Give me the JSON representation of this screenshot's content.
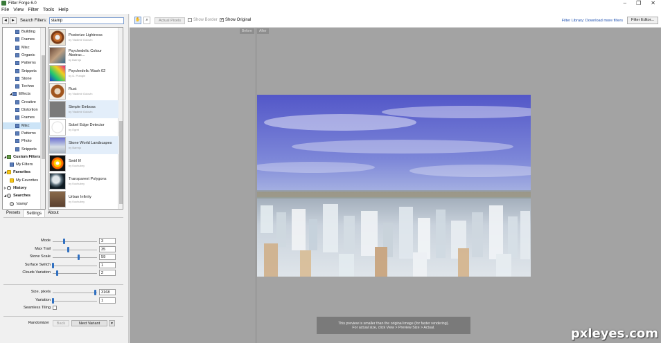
{
  "window": {
    "title": "Filter Forge 6.0",
    "controls": [
      "–",
      "❐",
      "✕"
    ]
  },
  "menu": [
    "File",
    "View",
    "Filter",
    "Tools",
    "Help"
  ],
  "search": {
    "label": "Search Filters:",
    "value": "stamp",
    "back": "◄",
    "forward": "►"
  },
  "tree": [
    {
      "label": "Building",
      "indent": 2,
      "icon": "folder"
    },
    {
      "label": "Frames",
      "indent": 2,
      "icon": "folder"
    },
    {
      "label": "Misc",
      "indent": 2,
      "icon": "folder"
    },
    {
      "label": "Organic",
      "indent": 2,
      "icon": "folder"
    },
    {
      "label": "Patterns",
      "indent": 2,
      "icon": "folder"
    },
    {
      "label": "Snippets",
      "indent": 2,
      "icon": "folder"
    },
    {
      "label": "Stone",
      "indent": 2,
      "icon": "folder"
    },
    {
      "label": "Techno",
      "indent": 2,
      "icon": "folder"
    },
    {
      "label": "Effects",
      "indent": 1,
      "icon": "folder",
      "expander": "◢"
    },
    {
      "label": "Creative",
      "indent": 2,
      "icon": "folder"
    },
    {
      "label": "Distortion",
      "indent": 2,
      "icon": "folder"
    },
    {
      "label": "Frames",
      "indent": 2,
      "icon": "folder"
    },
    {
      "label": "Misc",
      "indent": 2,
      "icon": "folder",
      "selected": true
    },
    {
      "label": "Patterns",
      "indent": 2,
      "icon": "folder"
    },
    {
      "label": "Photo",
      "indent": 2,
      "icon": "folder"
    },
    {
      "label": "Snippets",
      "indent": 2,
      "icon": "folder"
    },
    {
      "label": "Custom Filters",
      "indent": 0,
      "icon": "special",
      "bold": true,
      "expander": "◢"
    },
    {
      "label": "My Filters",
      "indent": 1,
      "icon": "folder"
    },
    {
      "label": "Favorites",
      "indent": 0,
      "icon": "star",
      "bold": true,
      "expander": "◢"
    },
    {
      "label": "My Favorites",
      "indent": 1,
      "icon": "star"
    },
    {
      "label": "History",
      "indent": 0,
      "icon": "clock",
      "bold": true,
      "expander": "▷"
    },
    {
      "label": "Searches",
      "indent": 0,
      "icon": "mag",
      "bold": true,
      "expander": "◢"
    },
    {
      "label": "'stamp'",
      "indent": 1,
      "icon": "mag"
    }
  ],
  "filters": [
    {
      "name": "Posterize Lightness",
      "author": "by Vladimir Golovin",
      "thumb": "radial-gradient(circle at 50% 50%, #eee 0 3px, #c46b2a 4px 6px, #7a3b16 7px 9px, #e8e0d0 10px)"
    },
    {
      "name": "Psychedelic Colour Abstrac...",
      "author": "by Barrnjo",
      "thumb": "linear-gradient(135deg, #6a4a3a, #c0a080, #3a6a8a)"
    },
    {
      "name": "Psychedelic Wash 02",
      "author": "by D. Prangle",
      "thumb": "linear-gradient(45deg, #1a3fcf, #24c86f, #f0d020, #e8208a)"
    },
    {
      "name": "Rust",
      "author": "by Vladimir Golovin",
      "thumb": "radial-gradient(circle, #e8d6c0 0 4px, #a0551d 5px 9px, #f2efe9 10px)"
    },
    {
      "name": "Simple Emboss",
      "author": "by Vladimir Golovin",
      "thumb": "linear-gradient(#7a7a7a, #7a7a7a)",
      "selected": true
    },
    {
      "name": "Sobel Edge Detector",
      "author": "by Egret",
      "thumb": "radial-gradient(circle, #fff 0 7px, #ddd 8px, #fff 9px)"
    },
    {
      "name": "Stone World Landscapes",
      "author": "by Barrnjo",
      "thumb": "linear-gradient(#6b6fd0, #b7c0e0 45%, #d7dde5 60%, #a9b4c2)",
      "selected": true
    },
    {
      "name": "Swirl It!",
      "author": "by Kochubey",
      "thumb": "radial-gradient(circle, #fff 0 2px, #ffd000 3px 5px, #ff6a00 6px 8px, #111 9px)"
    },
    {
      "name": "Transparent Polygons",
      "author": "by Kochubey",
      "thumb": "radial-gradient(circle at 40% 40%, #dfe6ea 0 5px, #5a6e7a 8px, #0e1a22 12px)"
    },
    {
      "name": "Urban Infinity",
      "author": "by Kochubey",
      "thumb": "linear-gradient(#8a6a4a, #5a4030)"
    }
  ],
  "tabs": [
    {
      "label": "Presets",
      "active": false
    },
    {
      "label": "Settings",
      "active": true
    },
    {
      "label": "About",
      "active": false
    }
  ],
  "params": [
    {
      "label": "Mode",
      "value": "3",
      "pos": 0.25
    },
    {
      "label": "Max Trail",
      "value": "35",
      "pos": 0.35
    },
    {
      "label": "Stone Scale",
      "value": "59",
      "pos": 0.59
    },
    {
      "label": "Surface Switch",
      "value": "1",
      "pos": 0.0
    },
    {
      "label": "Clouds Variation",
      "value": "2",
      "pos": 0.1
    }
  ],
  "params2": [
    {
      "label": "Size, pixels",
      "value": "3168",
      "pos": 0.97
    },
    {
      "label": "Variation",
      "value": "1",
      "pos": 0.0
    }
  ],
  "seamless": {
    "label": "Seamless Tiling"
  },
  "randomizer": {
    "label": "Randomizer",
    "back": "Back",
    "next": "Next Variant"
  },
  "toolbar": {
    "actual_pixels": "Actual Pixels",
    "show_border": "Show Border",
    "show_original": "Show Original",
    "library_link": "Filter Library: Download more filters",
    "filter_editor": "Filter Editor..."
  },
  "preview": {
    "before": "Before",
    "after": "After",
    "notice_line1": "This preview is smaller than the original image (for faster rendering).",
    "notice_line2": "For actual size, click View > Preview Size > Actual.",
    "watermark": "pxleyes.com"
  }
}
